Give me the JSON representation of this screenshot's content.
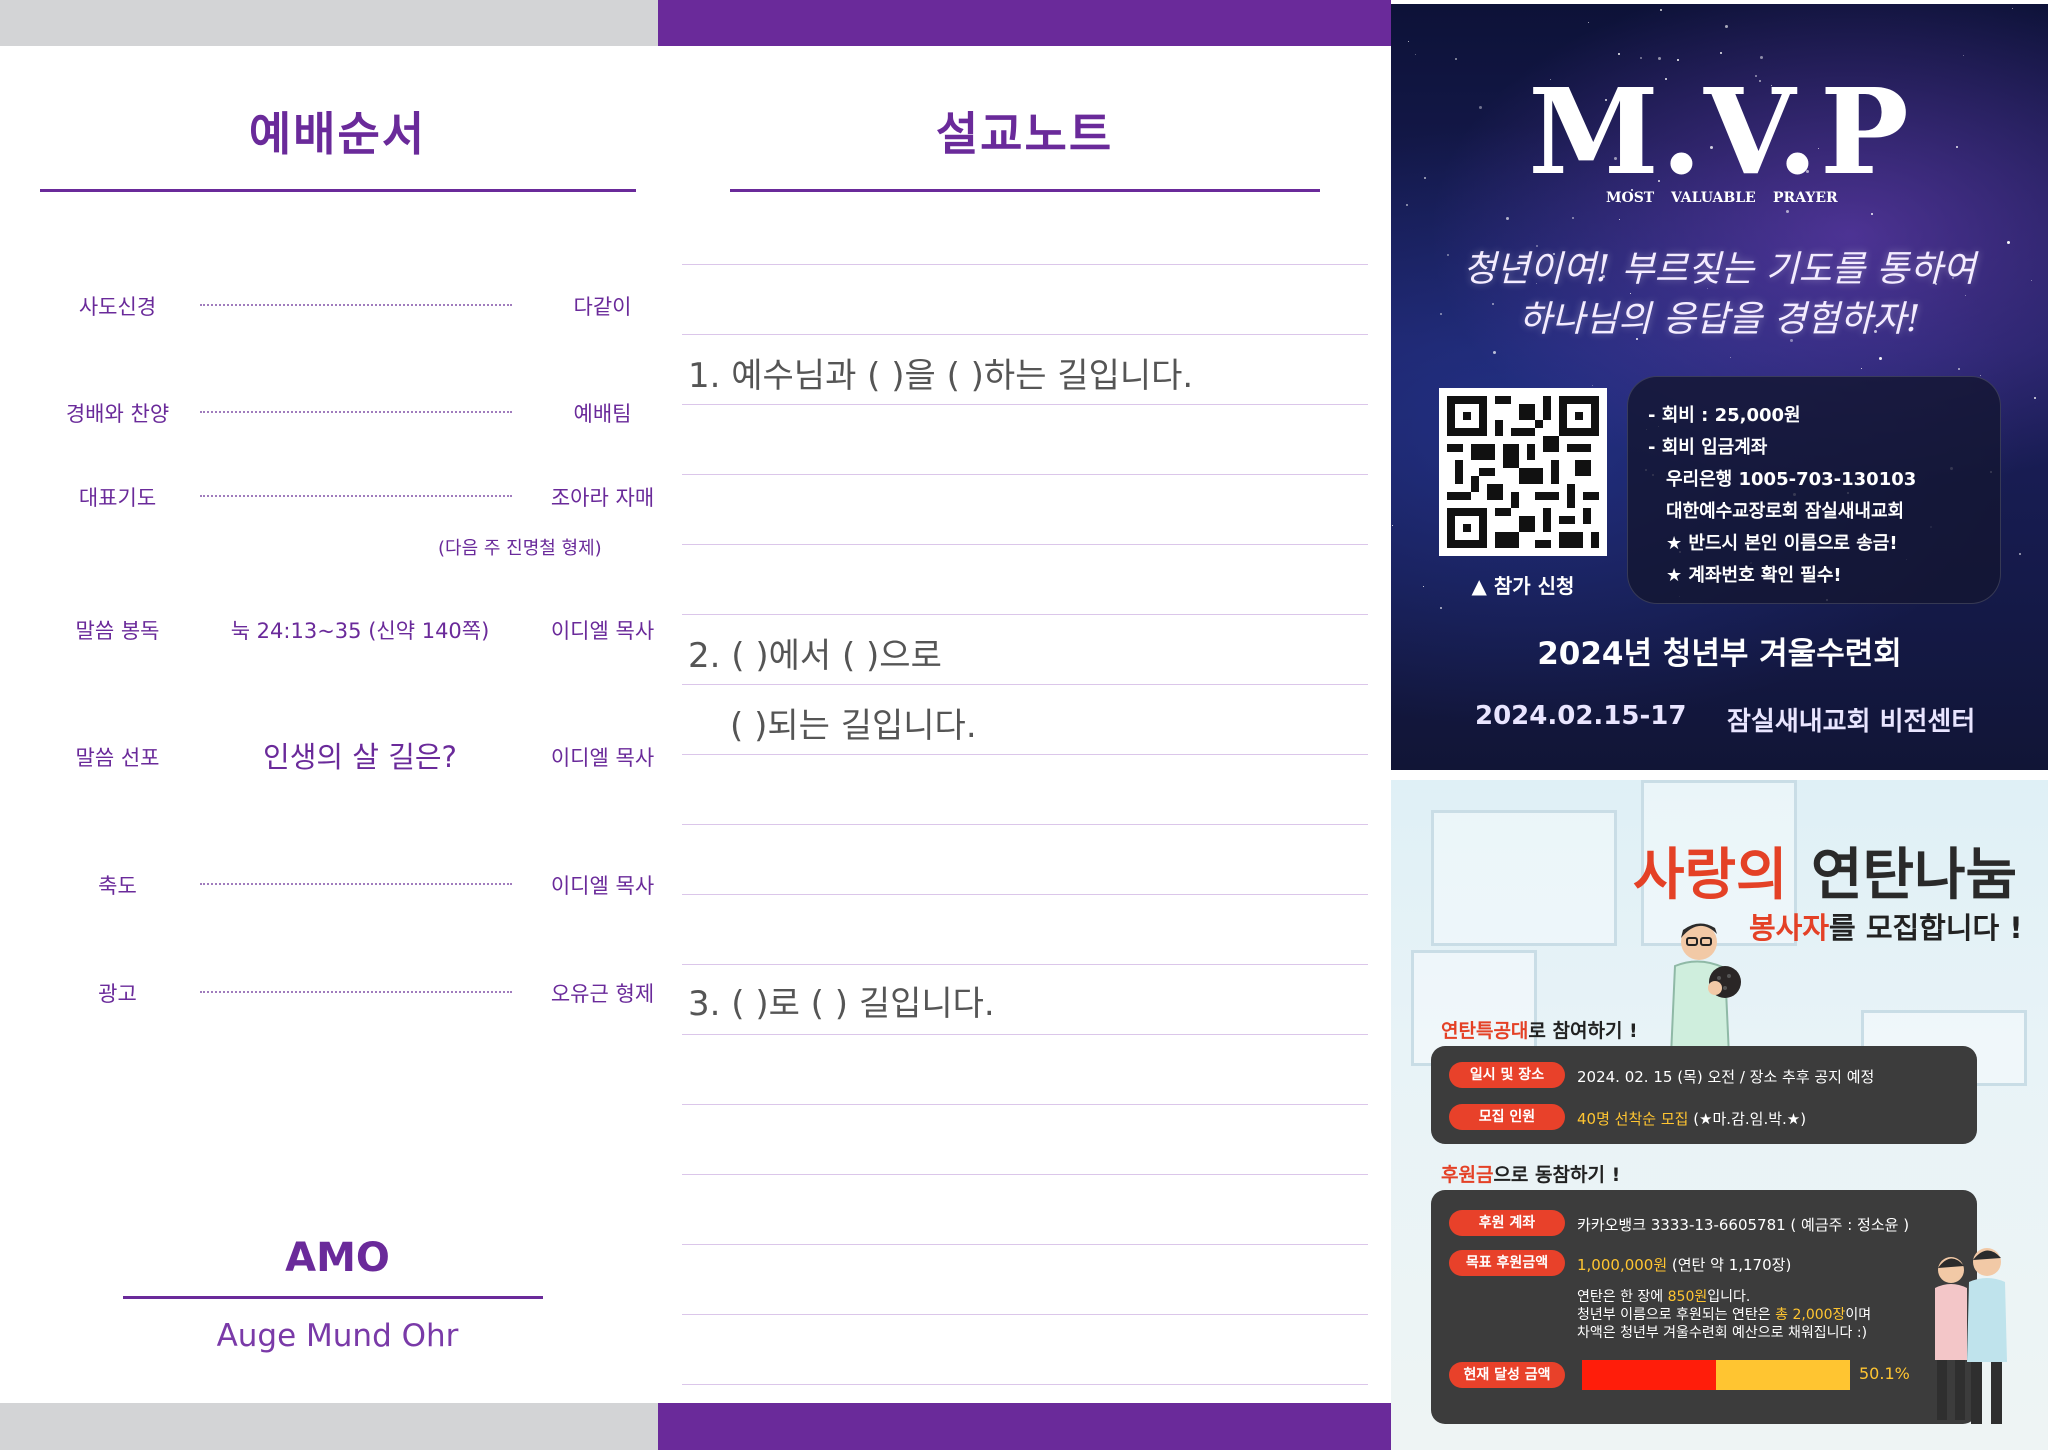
{
  "worship": {
    "title": "예배순서",
    "items": [
      {
        "label": "사도신경",
        "right": "다같이"
      },
      {
        "label": "경배와 찬양",
        "right": "예배팀"
      },
      {
        "label": "대표기도",
        "right": "조아라 자매"
      },
      {
        "label": "말씀 봉독",
        "mid": "눅 24:13~35 (신약 140쪽)",
        "right": "이디엘 목사"
      },
      {
        "label": "말씀 선포",
        "mid": "인생의 살 길은?",
        "right": "이디엘 목사"
      },
      {
        "label": "축도",
        "right": "이디엘 목사"
      },
      {
        "label": "광고",
        "right": "오유근 형제"
      }
    ],
    "next_week_note": "(다음 주 진명철 형제)",
    "footer_title": "AMO",
    "footer_sub": "Auge Mund Ohr"
  },
  "sermon": {
    "title": "설교노트",
    "line1": "1. 예수님과 (        )을 (        )하는 길입니다.",
    "line2a": "2. (           )에서 (           )으로",
    "line2b": "(        )되는 길입니다.",
    "line3": "3. (           )로 (           ) 길입니다."
  },
  "mvp": {
    "title": "M.V.P",
    "sub1": "MOST",
    "sub2": "VALUABLE",
    "sub3": "PRAYER",
    "slogan1": "청년이여! 부르짖는 기도를 통하여",
    "slogan2": "하나님의 응답을 경험하자!",
    "qr_caption": "▲ 참가 신청",
    "info": [
      "- 회비 : 25,000원",
      "- 회비 입금계좌",
      "우리은행 1005-703-130103",
      "대한예수교장로회 잠실새내교회",
      "★ 반드시 본인 이름으로 송금!",
      "★ 계좌번호 확인 필수!"
    ],
    "event": "2024년 청년부 겨울수련회",
    "date": "2024.02.15-17",
    "venue": "잠실새내교회 비전센터"
  },
  "coal": {
    "title_red": "사랑의",
    "title_dark": "연탄나눔",
    "sub_red": "봉사자",
    "sub_rest": "를 모집합니다 !",
    "sec1_red": "연탄특공대",
    "sec1_rest": "로 참여하기 !",
    "row1_label": "일시 및 장소",
    "row1_value": "2024. 02. 15 (목) 오전 / 장소 추후 공지 예정",
    "row2_label": "모집 인원",
    "row2_value_yel": "40명 선착순 모집",
    "row2_value_rest": " (★마.감.임.박.★)",
    "sec2_red": "후원금",
    "sec2_rest": "으로 동참하기 !",
    "row3_label": "후원 계좌",
    "row3_value": "카카오뱅크 3333-13-6605781 ( 예금주 : 정소윤 )",
    "row4_label": "목표 후원금액",
    "row4_value_yel": "1,000,000원",
    "row4_value_rest": " (연탄 약 1,170장)",
    "note1_a": "연탄은 한 장에 ",
    "note1_yel": "850원",
    "note1_b": "입니다.",
    "note2_a": "청년부 이름으로 후원되는 연탄은 ",
    "note2_yel": "총 2,000장",
    "note2_b": "이며",
    "note3": "차액은 청년부 겨울수련회 예산으로 채워집니다 :)",
    "row5_label": "현재 달성 금액",
    "progress_pct": 50.1,
    "progress_label": "50.1%"
  },
  "colors": {
    "purple": "#6a2a9a",
    "red": "#e44126",
    "yellow": "#ffc531"
  }
}
